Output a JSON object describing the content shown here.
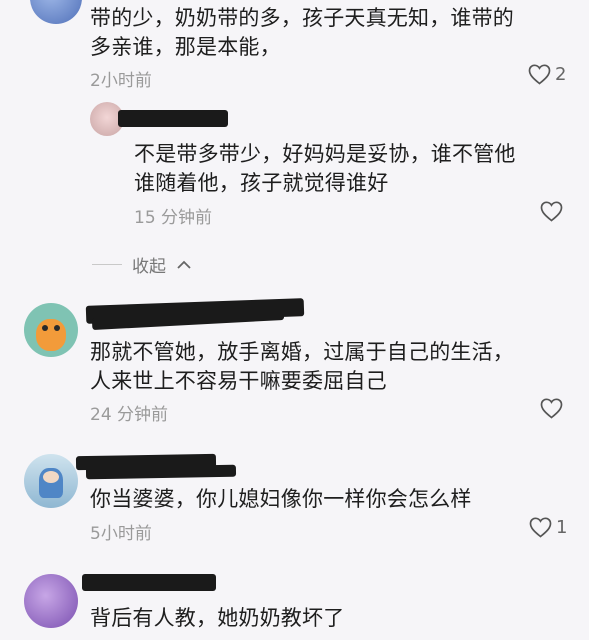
{
  "comments": [
    {
      "text_lines": [
        "带的少，奶奶带的多，孩子天真无知，谁带的",
        "多亲谁，那是本能，"
      ],
      "time": "2小时前",
      "likes": "2",
      "replies": [
        {
          "text_lines": [
            "不是带多带少，好妈妈是妥协，谁不管他",
            "谁随着他，孩子就觉得谁好"
          ],
          "time": "15 分钟前",
          "likes": ""
        }
      ],
      "collapse_label": "收起"
    },
    {
      "text_lines": [
        "那就不管她，放手离婚，过属于自己的生活，",
        "人来世上不容易干嘛要委屈自己"
      ],
      "time": "24 分钟前",
      "likes": ""
    },
    {
      "text_lines": [
        "你当婆婆，你儿媳妇像你一样你会怎么样"
      ],
      "time": "5小时前",
      "likes": "1"
    },
    {
      "text_lines": [
        "背后有人教，她奶奶教坏了"
      ]
    }
  ],
  "icons": {
    "like": "heart-outline-icon",
    "collapse": "chevron-up-icon"
  },
  "colors": {
    "background": "#f6f5f8",
    "text": "#1e1e1e",
    "meta": "#9a9a9a",
    "redaction": "#1a1a1a"
  }
}
